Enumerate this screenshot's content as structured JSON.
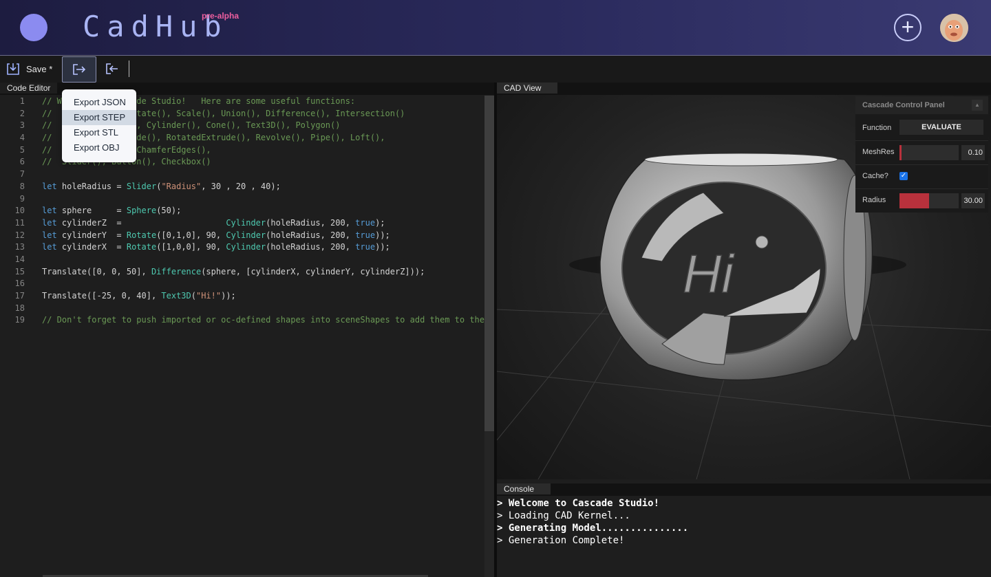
{
  "header": {
    "brand": "CadHub",
    "badge": "pre-alpha",
    "add_label": "+"
  },
  "toolbar": {
    "save_label": "Save *"
  },
  "export_menu": {
    "items": [
      "Export JSON",
      "Export STEP",
      "Export STL",
      "Export OBJ"
    ],
    "highlighted": "Export STEP"
  },
  "editor": {
    "tab": "Code Editor",
    "lines": [
      {
        "n": "1",
        "text": "// Welcome to Cascade Studio!   Here are some useful functions:"
      },
      {
        "n": "2",
        "text": "//  Translate(), Rotate(), Scale(), Union(), Difference(), Intersection()"
      },
      {
        "n": "3",
        "text": "//  Box(), Sphere(), Cylinder(), Cone(), Text3D(), Polygon()"
      },
      {
        "n": "4",
        "text": "//  Offset(), Extrude(), RotatedExtrude(), Revolve(), Pipe(), Loft(),"
      },
      {
        "n": "5",
        "text": "//  FilletEdges(), ChamferEdges(),"
      },
      {
        "n": "6",
        "text": "//  Slider(), Button(), Checkbox()"
      },
      {
        "n": "7",
        "text": ""
      },
      {
        "n": "8",
        "text": "let holeRadius = Slider(\"Radius\", 30 , 20 , 40);"
      },
      {
        "n": "9",
        "text": ""
      },
      {
        "n": "10",
        "text": "let sphere     = Sphere(50);"
      },
      {
        "n": "11",
        "text": "let cylinderZ  =                     Cylinder(holeRadius, 200, true);"
      },
      {
        "n": "12",
        "text": "let cylinderY  = Rotate([0,1,0], 90, Cylinder(holeRadius, 200, true));"
      },
      {
        "n": "13",
        "text": "let cylinderX  = Rotate([1,0,0], 90, Cylinder(holeRadius, 200, true));"
      },
      {
        "n": "14",
        "text": ""
      },
      {
        "n": "15",
        "text": "Translate([0, 0, 50], Difference(sphere, [cylinderX, cylinderY, cylinderZ]));"
      },
      {
        "n": "16",
        "text": ""
      },
      {
        "n": "17",
        "text": "Translate([-25, 0, 40], Text3D(\"Hi!\"));"
      },
      {
        "n": "18",
        "text": ""
      },
      {
        "n": "19",
        "text": "// Don't forget to push imported or oc-defined shapes into sceneShapes to add them to the wo"
      }
    ]
  },
  "cad": {
    "tab": "CAD View",
    "model_text": "Hi"
  },
  "panel": {
    "title": "Cascade Control Panel",
    "function_label": "Function",
    "evaluate_label": "EVALUATE",
    "meshres_label": "MeshRes",
    "meshres_value": "0.10",
    "meshres_fraction": 0.04,
    "cache_label": "Cache?",
    "cache_checked": true,
    "radius_label": "Radius",
    "radius_value": "30.00",
    "radius_fraction": 0.5
  },
  "console": {
    "tab": "Console",
    "lines": [
      {
        "text": "> Welcome to Cascade Studio!",
        "bold": true
      },
      {
        "text": "> Loading CAD Kernel...",
        "bold": false
      },
      {
        "text": "> Generating Model...............",
        "bold": true
      },
      {
        "text": "> Generation Complete!",
        "bold": false
      }
    ]
  },
  "colors": {
    "accent": "#8b8bf0",
    "badge": "#ee5f9f",
    "slider_fill": "#b8313c"
  }
}
